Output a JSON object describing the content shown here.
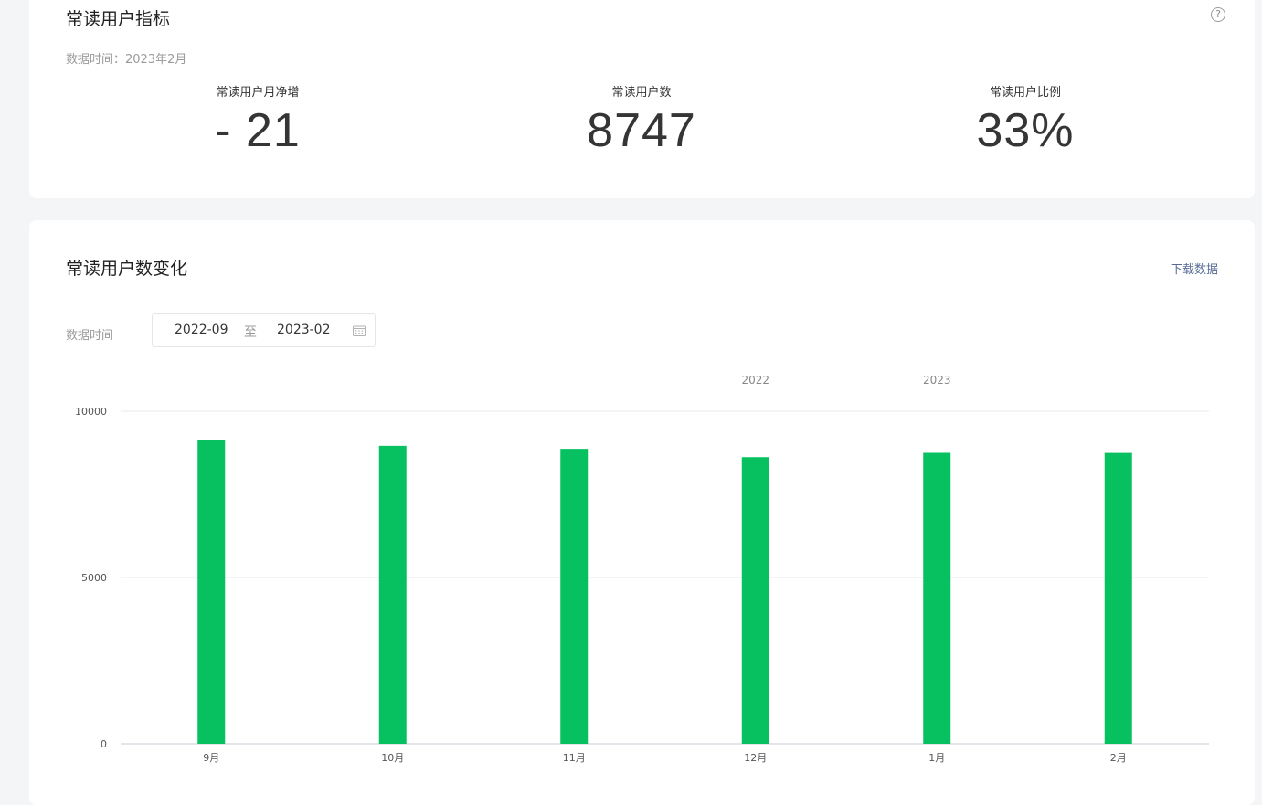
{
  "metrics_card": {
    "title": "常读用户指标",
    "help_icon": "question-circle-icon",
    "data_time": "数据时间：2023年2月",
    "metrics": [
      {
        "label": "常读用户月净增",
        "value": "- 21"
      },
      {
        "label": "常读用户数",
        "value": "8747"
      },
      {
        "label": "常读用户比例",
        "value": "33%"
      }
    ]
  },
  "trend_card": {
    "title": "常读用户数变化",
    "download_label": "下载数据",
    "filter_label": "数据时间",
    "date_start": "2022-09",
    "date_separator": "至",
    "date_end": "2023-02",
    "calendar_icon": "calendar-icon"
  },
  "colors": {
    "bar": "#07c160",
    "accent_link": "#576b95"
  },
  "chart_data": {
    "type": "bar",
    "categories": [
      "9月",
      "10月",
      "11月",
      "12月",
      "1月",
      "2月"
    ],
    "series": [
      {
        "values": [
          9140,
          8960,
          8870,
          8620,
          8750,
          8747
        ]
      }
    ],
    "year_labels": [
      {
        "category_index": 3,
        "label": "2022"
      },
      {
        "category_index": 4,
        "label": "2023"
      }
    ],
    "ylim": [
      0,
      10000
    ],
    "yticks": [
      0,
      5000,
      10000
    ],
    "grid": true,
    "xlabel": "",
    "ylabel": ""
  }
}
